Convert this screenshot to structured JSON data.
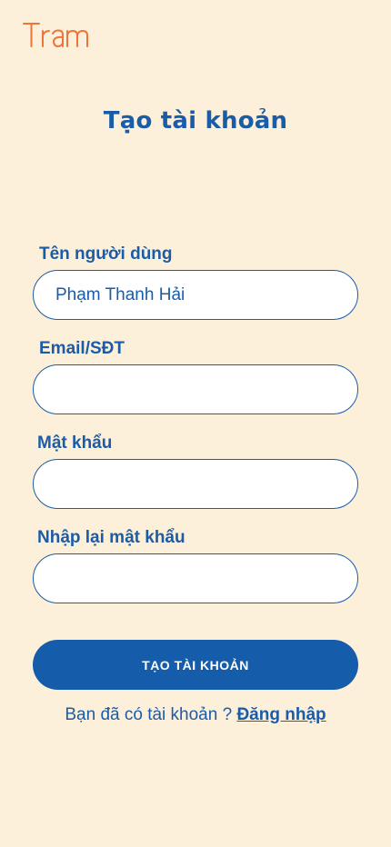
{
  "brand": {
    "logo_text": "Tram",
    "color": "#F0743A"
  },
  "title": "Tạo tài khoản",
  "form": {
    "username": {
      "label": "Tên người dùng",
      "value": "Phạm Thanh Hải",
      "placeholder": ""
    },
    "email_phone": {
      "label": "Email/SĐT",
      "value": "",
      "placeholder": ""
    },
    "password": {
      "label": "Mật khẩu",
      "value": "",
      "placeholder": ""
    },
    "confirm_password": {
      "label": "Nhập lại mật khẩu",
      "value": "",
      "placeholder": ""
    }
  },
  "submit_label": "TẠO TÀI KHOẢN",
  "footer": {
    "question": "Bạn đã có tài khoản ?",
    "link": "Đăng nhập"
  },
  "colors": {
    "background": "#FDF0DA",
    "primary": "#155CAA",
    "accent": "#F0743A"
  }
}
